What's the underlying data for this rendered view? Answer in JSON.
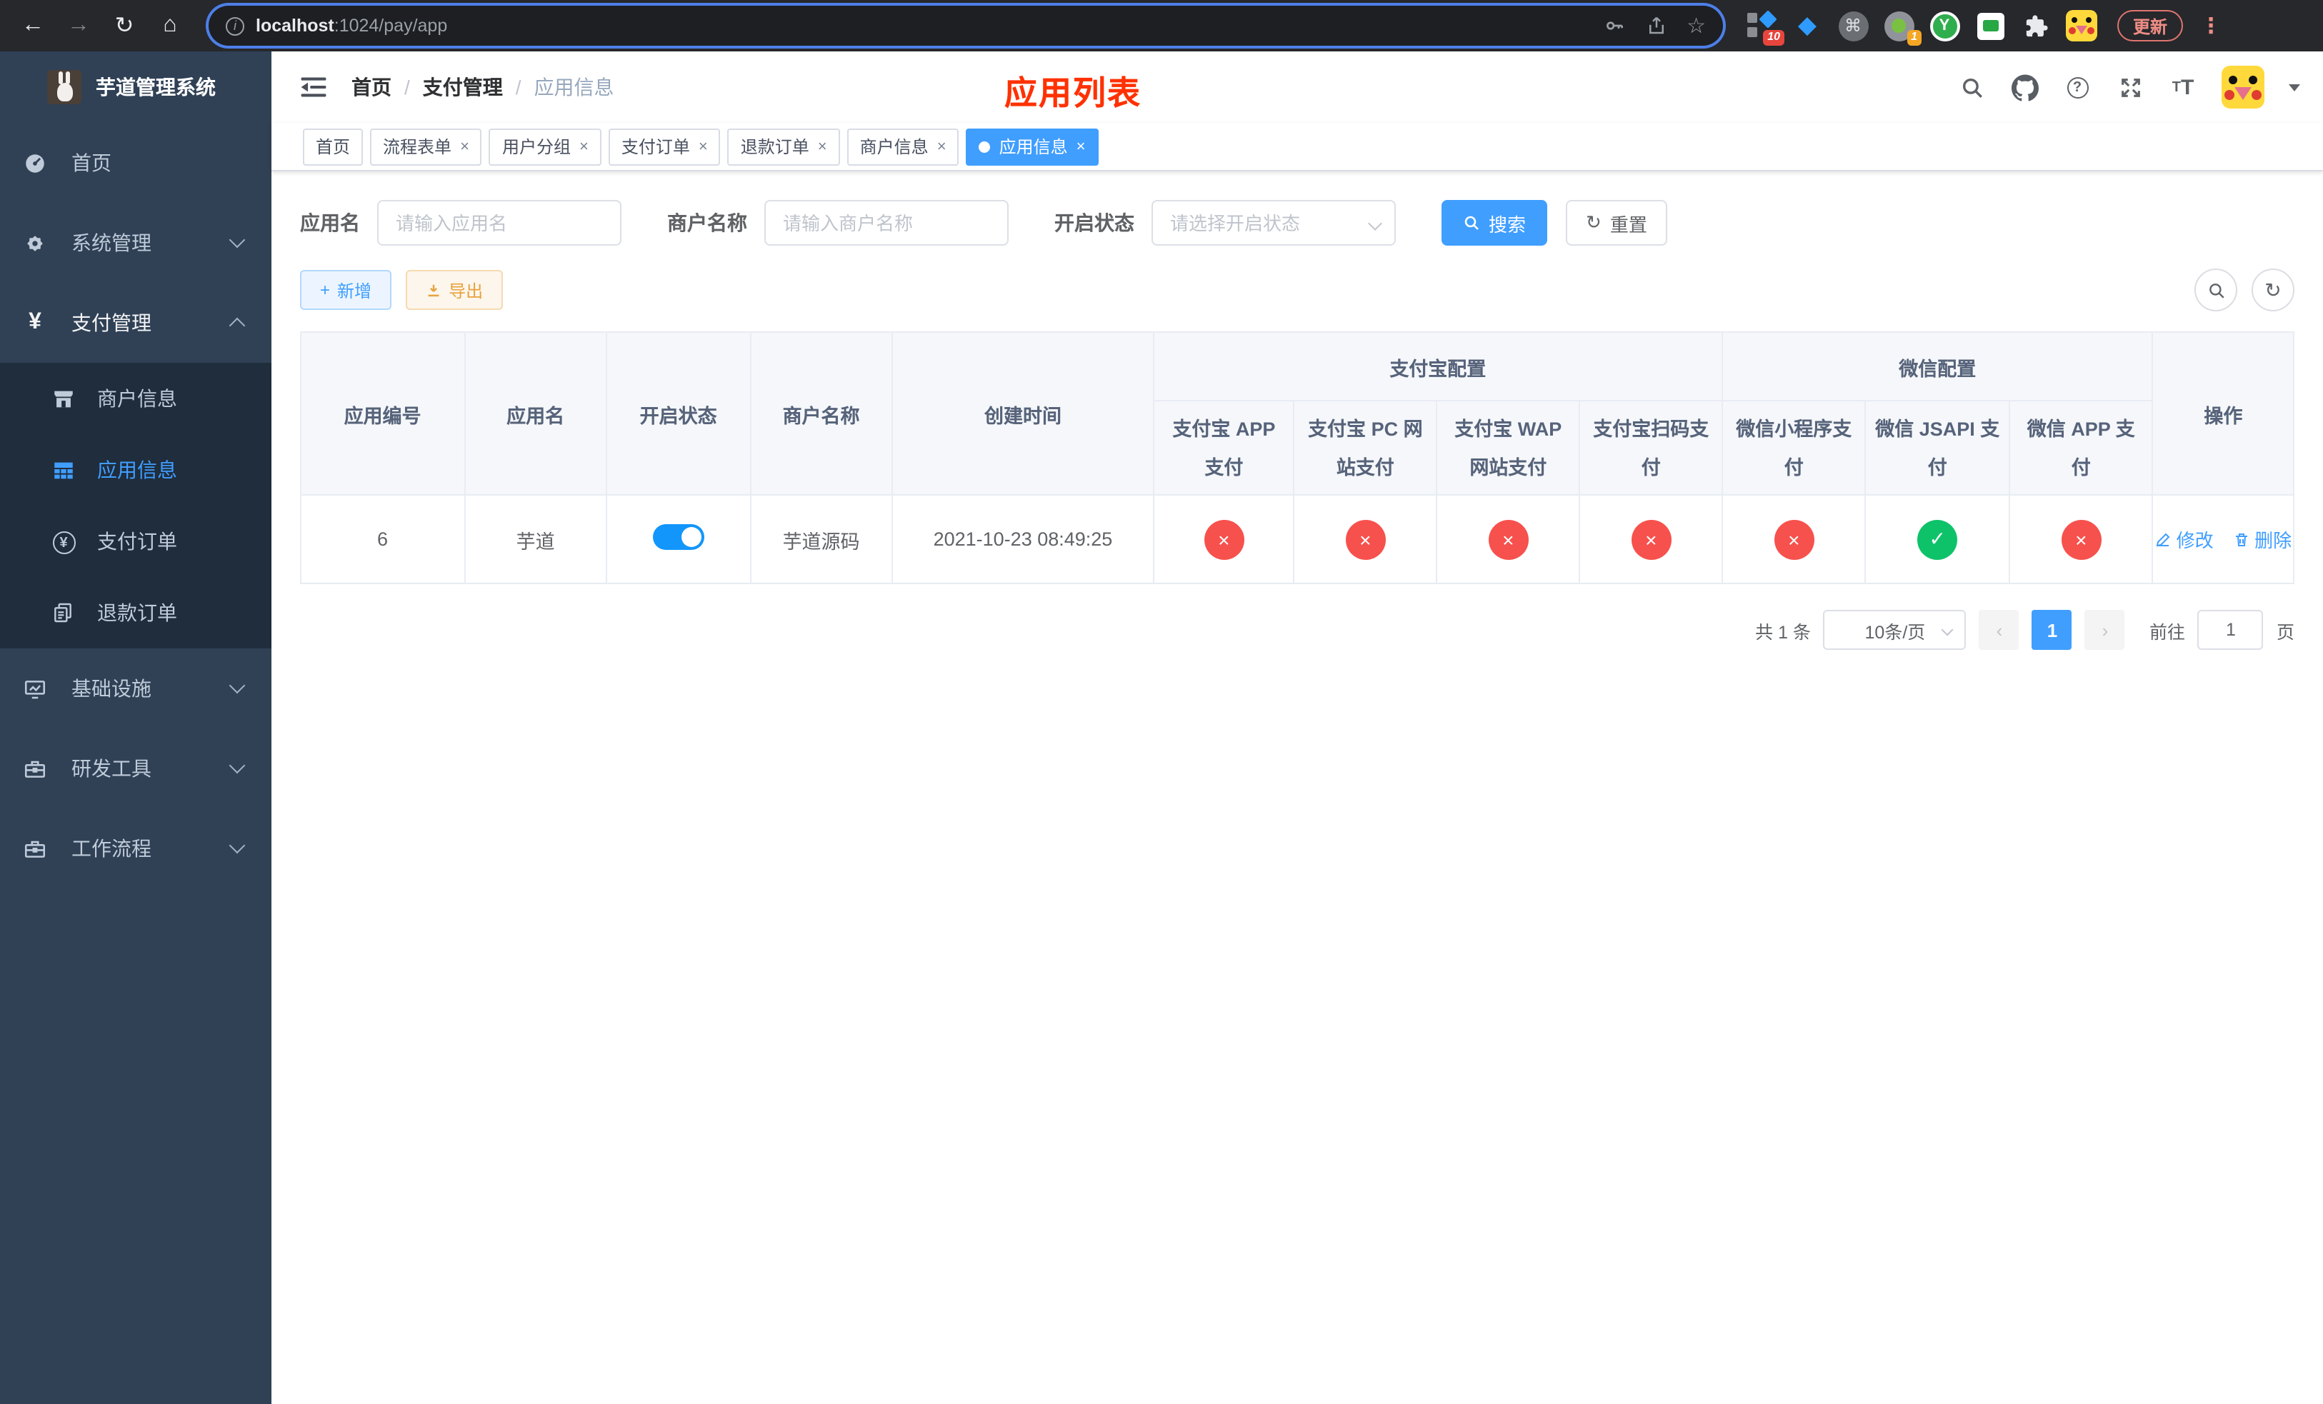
{
  "browser": {
    "url_host": "localhost",
    "url_rest": ":1024/pay/app",
    "update_label": "更新",
    "ext_badge_grid": "10",
    "ext_badge_record": "1",
    "ext_y_letter": "Y"
  },
  "sidebar": {
    "title": "芋道管理系统",
    "menu_home": "首页",
    "menu_system": "系统管理",
    "menu_pay": "支付管理",
    "menu_infra": "基础设施",
    "menu_dev": "研发工具",
    "menu_flow": "工作流程",
    "sub_merchant": "商户信息",
    "sub_app": "应用信息",
    "sub_order": "支付订单",
    "sub_refund": "退款订单"
  },
  "navbar": {
    "breadcrumb_home": "首页",
    "breadcrumb_pay": "支付管理",
    "breadcrumb_app": "应用信息",
    "overlay_title": "应用列表"
  },
  "tabs": [
    {
      "label": "首页"
    },
    {
      "label": "流程表单"
    },
    {
      "label": "用户分组"
    },
    {
      "label": "支付订单"
    },
    {
      "label": "退款订单"
    },
    {
      "label": "商户信息"
    },
    {
      "label": "应用信息"
    }
  ],
  "filters": {
    "app_name_label": "应用名",
    "app_name_placeholder": "请输入应用名",
    "merchant_label": "商户名称",
    "merchant_placeholder": "请输入商户名称",
    "status_label": "开启状态",
    "status_placeholder": "请选择开启状态",
    "search_label": "搜索",
    "reset_label": "重置"
  },
  "toolbar": {
    "add_label": "新增",
    "export_label": "导出"
  },
  "table": {
    "group_alipay": "支付宝配置",
    "group_wechat": "微信配置",
    "col_id": "应用编号",
    "col_name": "应用名",
    "col_enabled": "开启状态",
    "col_merchant": "商户名称",
    "col_created": "创建时间",
    "col_alipay_app": "支付宝 APP 支付",
    "col_alipay_pc": "支付宝 PC 网站支付",
    "col_alipay_wap": "支付宝 WAP 网站支付",
    "col_alipay_qr": "支付宝扫码支付",
    "col_wechat_lite": "微信小程序支付",
    "col_wechat_jsapi": "微信 JSAPI 支付",
    "col_wechat_app": "微信 APP 支付",
    "col_actions": "操作",
    "row": {
      "id": "6",
      "name": "芋道",
      "enabled": true,
      "merchant": "芋道源码",
      "created_at": "2021-10-23 08:49:25",
      "alipay_app": false,
      "alipay_pc": false,
      "alipay_wap": false,
      "alipay_qr": false,
      "wechat_lite": false,
      "wechat_jsapi": true,
      "wechat_app": false,
      "edit_label": "修改",
      "delete_label": "删除"
    }
  },
  "pagination": {
    "total": "共 1 条",
    "page_size": "10条/页",
    "page": "1",
    "goto_label": "前往",
    "goto_value": "1",
    "unit": "页"
  },
  "colors": {
    "primary": "#409eff",
    "success": "#0ec26a",
    "danger": "#f7514d",
    "warning": "#e6a23c",
    "sidebar_bg": "#304156",
    "submenu_bg": "#1f2d3d",
    "overlay_title": "#ff3100"
  }
}
